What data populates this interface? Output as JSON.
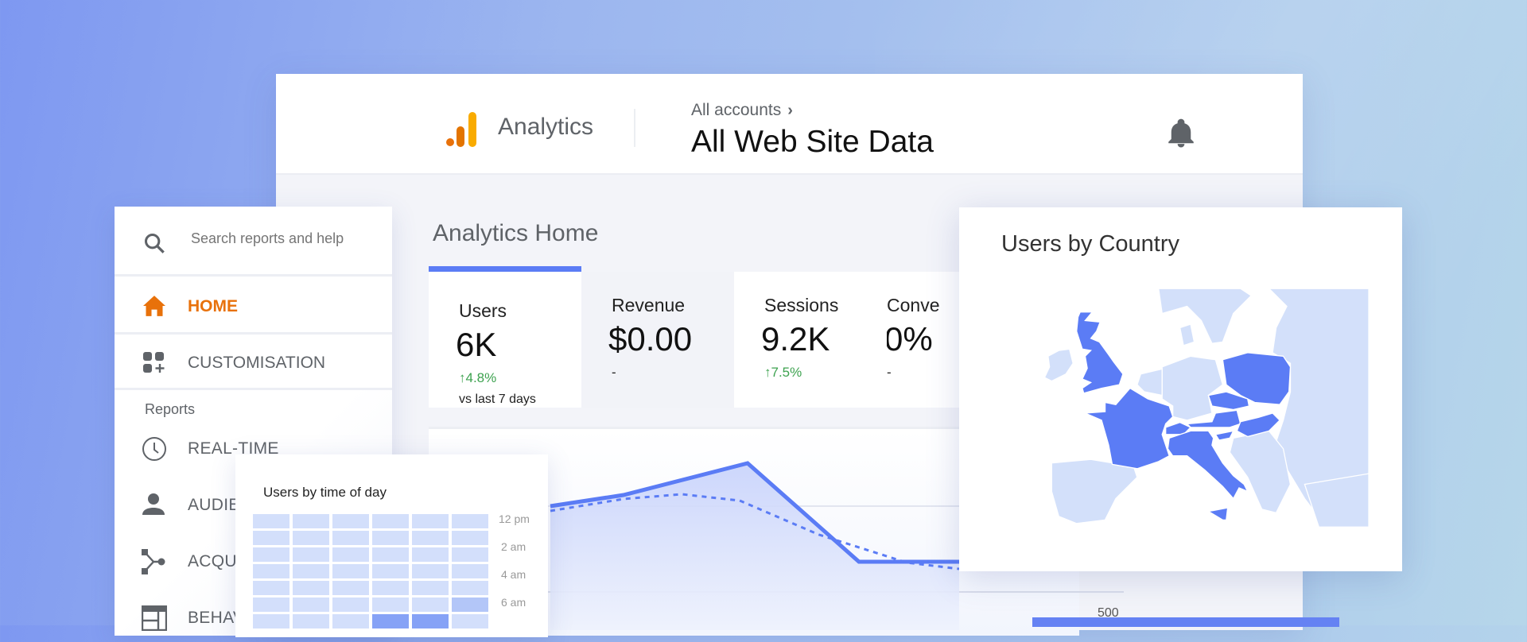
{
  "header": {
    "app_name": "Analytics",
    "breadcrumb": "All accounts",
    "breadcrumb_chevron": "›",
    "title": "All Web Site Data",
    "logo_colors": [
      "#e8710a",
      "#e37400",
      "#f9ab00"
    ]
  },
  "main": {
    "title": "Analytics Home",
    "tabs": [
      {
        "label": "Users",
        "value": "6K",
        "change": "↑4.8%",
        "sub": "vs last 7 days",
        "active": true
      },
      {
        "label": "Revenue",
        "value": "$0.00",
        "change": "-"
      },
      {
        "label": "Sessions",
        "value": "9.2K",
        "change": "↑7.5%"
      },
      {
        "label": "Conve",
        "value": "0%",
        "change": "-"
      }
    ],
    "axis_label": "500",
    "accent": "#5b7cf5"
  },
  "sidebar": {
    "search_placeholder": "Search reports and help",
    "items": [
      {
        "label": "HOME",
        "icon": "home-icon",
        "active": true
      },
      {
        "label": "CUSTOMISATION",
        "icon": "dashboard-add-icon"
      }
    ],
    "reports_heading": "Reports",
    "reports": [
      {
        "label": "REAL-TIME",
        "icon": "clock-icon"
      },
      {
        "label": "AUDIENCE",
        "icon": "person-icon"
      },
      {
        "label": "ACQUISITION",
        "icon": "acquisition-icon"
      },
      {
        "label": "BEHAVIOUR",
        "icon": "behaviour-icon"
      }
    ],
    "active_color": "#e8710a"
  },
  "time_of_day": {
    "title": "Users by time of day",
    "row_labels": [
      "12 pm",
      "2 am",
      "4 am",
      "6 am"
    ]
  },
  "country": {
    "title": "Users by Country",
    "highlight": "#5b7cf5",
    "base": "#d3e0fa"
  }
}
